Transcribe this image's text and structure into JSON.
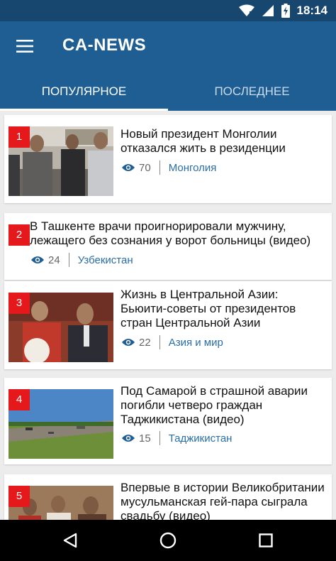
{
  "statusbar": {
    "time": "18:14",
    "icons": [
      "wifi-icon",
      "signal-icon",
      "battery-charging-icon"
    ]
  },
  "app": {
    "title": "CA-NEWS"
  },
  "tabs": [
    {
      "label": "ПОПУЛЯРНОЕ",
      "active": true
    },
    {
      "label": "ПОСЛЕДНЕЕ",
      "active": false
    }
  ],
  "articles": [
    {
      "rank": "1",
      "title": "Новый президент Монголии отказался жить в резиденции",
      "views": "70",
      "tag": "Монголия"
    },
    {
      "rank": "2",
      "title": "В Ташкенте врачи проигнорировали мужчину, лежащего без сознания у ворот больницы (видео)",
      "views": "24",
      "tag": "Узбекистан"
    },
    {
      "rank": "3",
      "title": "Жизнь в Центральной Азии: Бьюити-советы от президентов стран Центральной Азии",
      "views": "22",
      "tag": "Азия и мир"
    },
    {
      "rank": "4",
      "title": "Под Самарой в страшной аварии погибли четверо граждан Таджикистана (видео)",
      "views": "15",
      "tag": "Таджикистан"
    },
    {
      "rank": "5",
      "title": "Впервые в истории Великобритании мусульманская гей-пара сыграла свадьбу (видео)",
      "views": "",
      "tag": ""
    }
  ],
  "colors": {
    "appbar": "#1e5e93",
    "statusbar": "#17466f",
    "rank_badge": "#e5191b",
    "tag_link": "#2a6ea8"
  }
}
